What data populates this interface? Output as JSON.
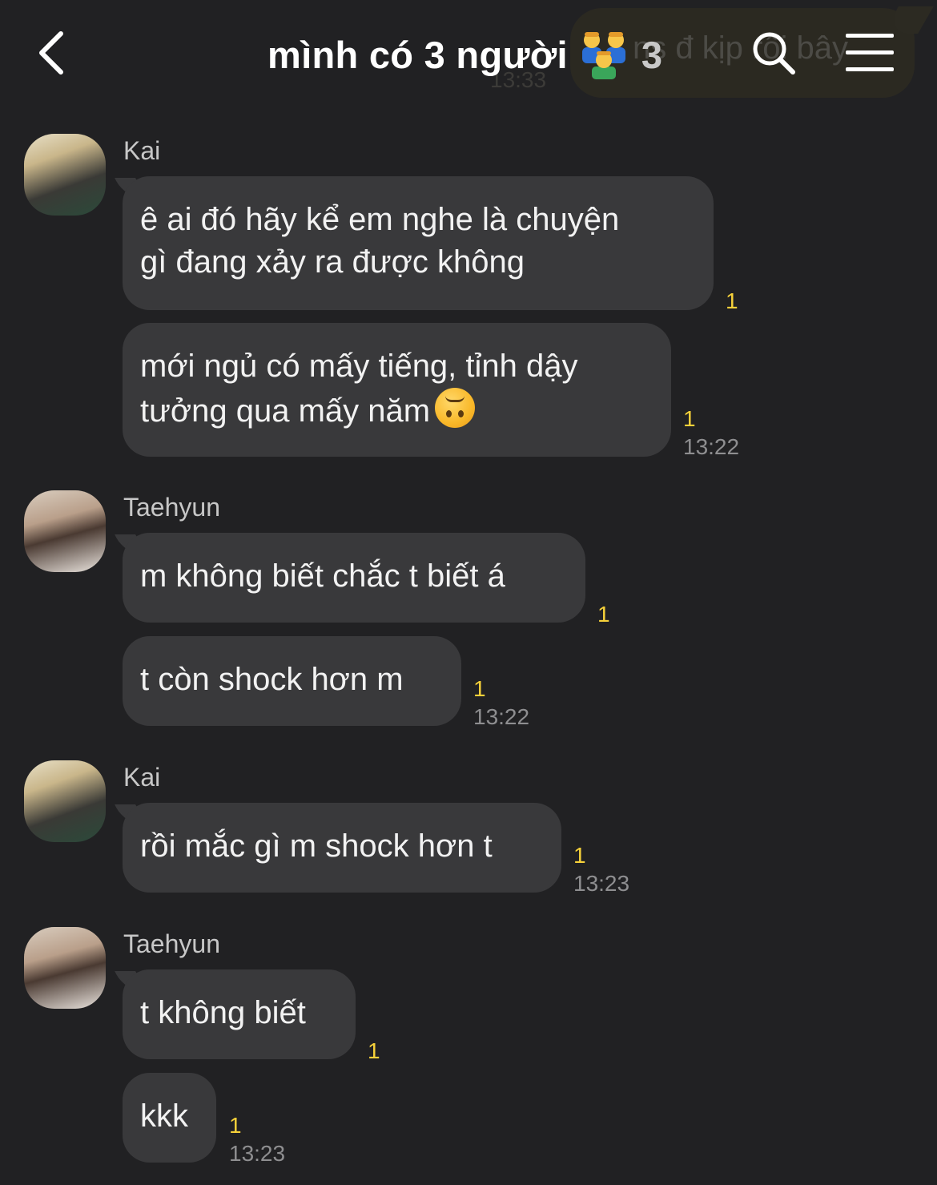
{
  "header": {
    "title": "mình có 3 người",
    "group_emoji": "family-emoji",
    "member_count": "3",
    "ghost_text": "ns đ kịp rồi bây",
    "ghost_time": "13:33",
    "icons": {
      "back": "chevron-left-icon",
      "search": "search-icon",
      "menu": "hamburger-menu-icon"
    }
  },
  "colors": {
    "background": "#212123",
    "bubble": "#39393b",
    "unread": "#f6d13a",
    "time": "#8e8e90",
    "sender": "#c7c7c7"
  },
  "messages": [
    {
      "sender": "Kai",
      "items": [
        {
          "lines": [
            "ê ai đó hãy kể em nghe là chuyện",
            "gì đang xảy ra được không"
          ],
          "unread": "1"
        },
        {
          "lines": [
            "mới ngủ có mấy tiếng, tỉnh dậy",
            "tưởng qua mấy năm"
          ],
          "emoji": "upside-down-face-emoji",
          "unread": "1",
          "time": "13:22"
        }
      ]
    },
    {
      "sender": "Taehyun",
      "items": [
        {
          "lines": [
            "m không biết chắc t biết á"
          ],
          "unread": "1"
        },
        {
          "lines": [
            "t còn shock hơn m"
          ],
          "unread": "1",
          "time": "13:22"
        }
      ]
    },
    {
      "sender": "Kai",
      "items": [
        {
          "lines": [
            "rồi mắc gì m shock hơn t"
          ],
          "unread": "1",
          "time": "13:23"
        }
      ]
    },
    {
      "sender": "Taehyun",
      "items": [
        {
          "lines": [
            "t không biết"
          ],
          "unread": "1"
        },
        {
          "lines": [
            "kkk"
          ],
          "unread": "1",
          "time": "13:23"
        }
      ]
    }
  ]
}
